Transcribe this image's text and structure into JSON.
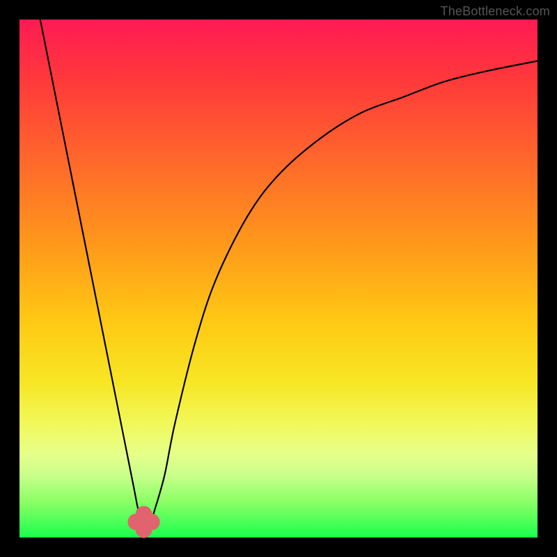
{
  "watermark": "TheBottleneck.com",
  "chart_data": {
    "type": "line",
    "title": "",
    "xlabel": "",
    "ylabel": "",
    "xlim": [
      0,
      100
    ],
    "ylim": [
      0,
      100
    ],
    "grid": false,
    "legend": false,
    "annotations": [],
    "series": [
      {
        "name": "bottleneck-curve",
        "color": "#000000",
        "x": [
          4,
          6,
          8,
          10,
          12,
          14,
          16,
          18,
          20,
          22,
          23,
          24,
          25,
          26,
          28,
          30,
          34,
          38,
          44,
          50,
          58,
          66,
          74,
          82,
          90,
          100
        ],
        "y": [
          100,
          90,
          80,
          70,
          60,
          50,
          40,
          30,
          20,
          10,
          5,
          2,
          2,
          5,
          12,
          22,
          38,
          50,
          62,
          70,
          77,
          82,
          85,
          88,
          90,
          92
        ]
      }
    ],
    "markers": [
      {
        "name": "min-marker-left",
        "x": 22.5,
        "y": 3,
        "r": 1.6,
        "color": "#e0636e"
      },
      {
        "name": "min-marker-center",
        "x": 24.0,
        "y": 1.5,
        "r": 1.6,
        "color": "#e0636e"
      },
      {
        "name": "min-marker-right",
        "x": 25.5,
        "y": 3,
        "r": 1.6,
        "color": "#e0636e"
      },
      {
        "name": "min-marker-top",
        "x": 24.0,
        "y": 4.5,
        "r": 1.6,
        "color": "#e0636e"
      }
    ]
  }
}
